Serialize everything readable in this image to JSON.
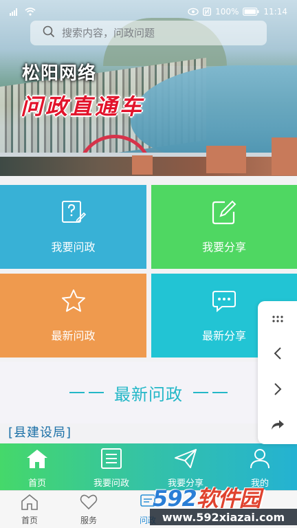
{
  "status_bar": {
    "battery_percent": "100%",
    "time": "11:14",
    "icons": [
      "wifi-icon",
      "eye-icon",
      "nfc-icon",
      "battery-icon"
    ]
  },
  "search": {
    "placeholder": "搜索内容，问政问题"
  },
  "banner": {
    "title_line1": "松阳网络",
    "title_line2": "问政直通车"
  },
  "tiles": [
    {
      "label": "我要问政",
      "icon": "question-edit-icon",
      "color": "#38b1d6"
    },
    {
      "label": "我要分享",
      "icon": "edit-square-icon",
      "color": "#4fd762"
    },
    {
      "label": "最新问政",
      "icon": "star-icon",
      "color": "#ef9a4e"
    },
    {
      "label": "最新分享",
      "icon": "chat-bubble-icon",
      "color": "#22c4d4"
    }
  ],
  "section": {
    "title": "最新问政"
  },
  "latest_item": {
    "department": "[县建设局]"
  },
  "app_nav": [
    {
      "label": "首页",
      "icon": "home-icon"
    },
    {
      "label": "我要问政",
      "icon": "document-icon"
    },
    {
      "label": "我要分享",
      "icon": "paper-plane-icon"
    },
    {
      "label": "我的",
      "icon": "user-icon"
    }
  ],
  "host_nav": [
    {
      "label": "首页",
      "icon": "home-outline-icon"
    },
    {
      "label": "服务",
      "icon": "heart-icon"
    },
    {
      "label": "问政",
      "icon": "message-icon",
      "active": true
    }
  ],
  "side_panel": [
    "more-dots-icon",
    "chevron-left-icon",
    "chevron-right-icon",
    "share-arrow-icon"
  ],
  "watermark": {
    "brand_num": "592",
    "brand_cn": "软件园",
    "url": "www.592xiazai.com"
  },
  "colors": {
    "accent": "#23b7c7",
    "dept": "#1a6fa6",
    "nav_gradient_start": "#45d86a",
    "nav_gradient_end": "#24b2d2"
  }
}
